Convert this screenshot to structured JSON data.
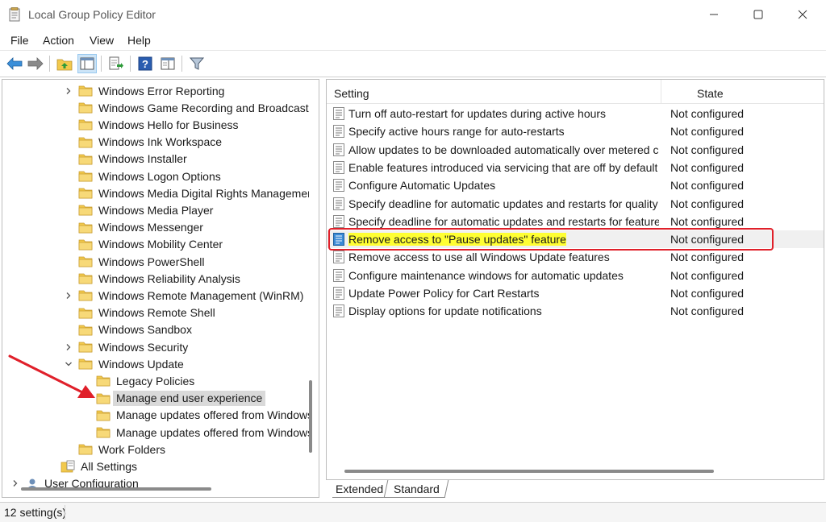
{
  "window": {
    "title": "Local Group Policy Editor",
    "icon": "policy-editor-icon"
  },
  "menu": {
    "file": "File",
    "action": "Action",
    "view": "View",
    "help": "Help"
  },
  "toolbar": {
    "icons": [
      "back-arrow-icon",
      "forward-arrow-icon",
      "up-folder-icon",
      "show-hide-tree-icon",
      "export-list-icon",
      "help-icon",
      "properties-icon",
      "filter-icon"
    ]
  },
  "tree": {
    "items": [
      {
        "label": "Windows Error Reporting",
        "level": 1,
        "expandable": true
      },
      {
        "label": "Windows Game Recording and Broadcasting",
        "level": 1,
        "expandable": false
      },
      {
        "label": "Windows Hello for Business",
        "level": 1,
        "expandable": false
      },
      {
        "label": "Windows Ink Workspace",
        "level": 1,
        "expandable": false
      },
      {
        "label": "Windows Installer",
        "level": 1,
        "expandable": false
      },
      {
        "label": "Windows Logon Options",
        "level": 1,
        "expandable": false
      },
      {
        "label": "Windows Media Digital Rights Management",
        "level": 1,
        "expandable": false
      },
      {
        "label": "Windows Media Player",
        "level": 1,
        "expandable": false
      },
      {
        "label": "Windows Messenger",
        "level": 1,
        "expandable": false
      },
      {
        "label": "Windows Mobility Center",
        "level": 1,
        "expandable": false
      },
      {
        "label": "Windows PowerShell",
        "level": 1,
        "expandable": false
      },
      {
        "label": "Windows Reliability Analysis",
        "level": 1,
        "expandable": false
      },
      {
        "label": "Windows Remote Management (WinRM)",
        "level": 1,
        "expandable": true
      },
      {
        "label": "Windows Remote Shell",
        "level": 1,
        "expandable": false
      },
      {
        "label": "Windows Sandbox",
        "level": 1,
        "expandable": false
      },
      {
        "label": "Windows Security",
        "level": 1,
        "expandable": true
      },
      {
        "label": "Windows Update",
        "level": 1,
        "expandable": true,
        "expanded": true
      },
      {
        "label": "Legacy Policies",
        "level": 2,
        "expandable": false
      },
      {
        "label": "Manage end user experience",
        "level": 2,
        "expandable": false,
        "selected": true
      },
      {
        "label": "Manage updates offered from Windows Server Update Service",
        "level": 2,
        "expandable": false
      },
      {
        "label": "Manage updates offered from Windows Update",
        "level": 2,
        "expandable": false
      },
      {
        "label": "Work Folders",
        "level": 1,
        "expandable": false
      },
      {
        "label": "All Settings",
        "level": 0,
        "expandable": false,
        "icon": "all-settings-icon"
      },
      {
        "label": "User Configuration",
        "level": -1,
        "expandable": true,
        "icon": "user-config-icon"
      }
    ]
  },
  "list": {
    "col_setting": "Setting",
    "col_state": "State",
    "rows": [
      {
        "name": "Turn off auto-restart for updates during active hours",
        "state": "Not configured"
      },
      {
        "name": "Specify active hours range for auto-restarts",
        "state": "Not configured"
      },
      {
        "name": "Allow updates to be downloaded automatically over metered connections",
        "state": "Not configured"
      },
      {
        "name": "Enable features introduced via servicing that are off by default",
        "state": "Not configured"
      },
      {
        "name": "Configure Automatic Updates",
        "state": "Not configured"
      },
      {
        "name": "Specify deadline for automatic updates and restarts for quality updates",
        "state": "Not configured"
      },
      {
        "name": "Specify deadline for automatic updates and restarts for feature updates",
        "state": "Not configured"
      },
      {
        "name": "Remove access to \"Pause updates\" feature",
        "state": "Not configured",
        "highlighted": true
      },
      {
        "name": "Remove access to use all Windows Update features",
        "state": "Not configured"
      },
      {
        "name": "Configure maintenance windows for automatic updates",
        "state": "Not configured"
      },
      {
        "name": "Update Power Policy for Cart Restarts",
        "state": "Not configured"
      },
      {
        "name": "Display options for update notifications",
        "state": "Not configured"
      }
    ]
  },
  "tabs": {
    "extended": "Extended",
    "standard": "Standard",
    "active": "standard"
  },
  "status": {
    "text": "12 setting(s)"
  },
  "colors": {
    "highlight": "#ffff33",
    "annotation": "#e0202a",
    "selection": "#d9d9d9",
    "folder": "#f2c94c"
  }
}
